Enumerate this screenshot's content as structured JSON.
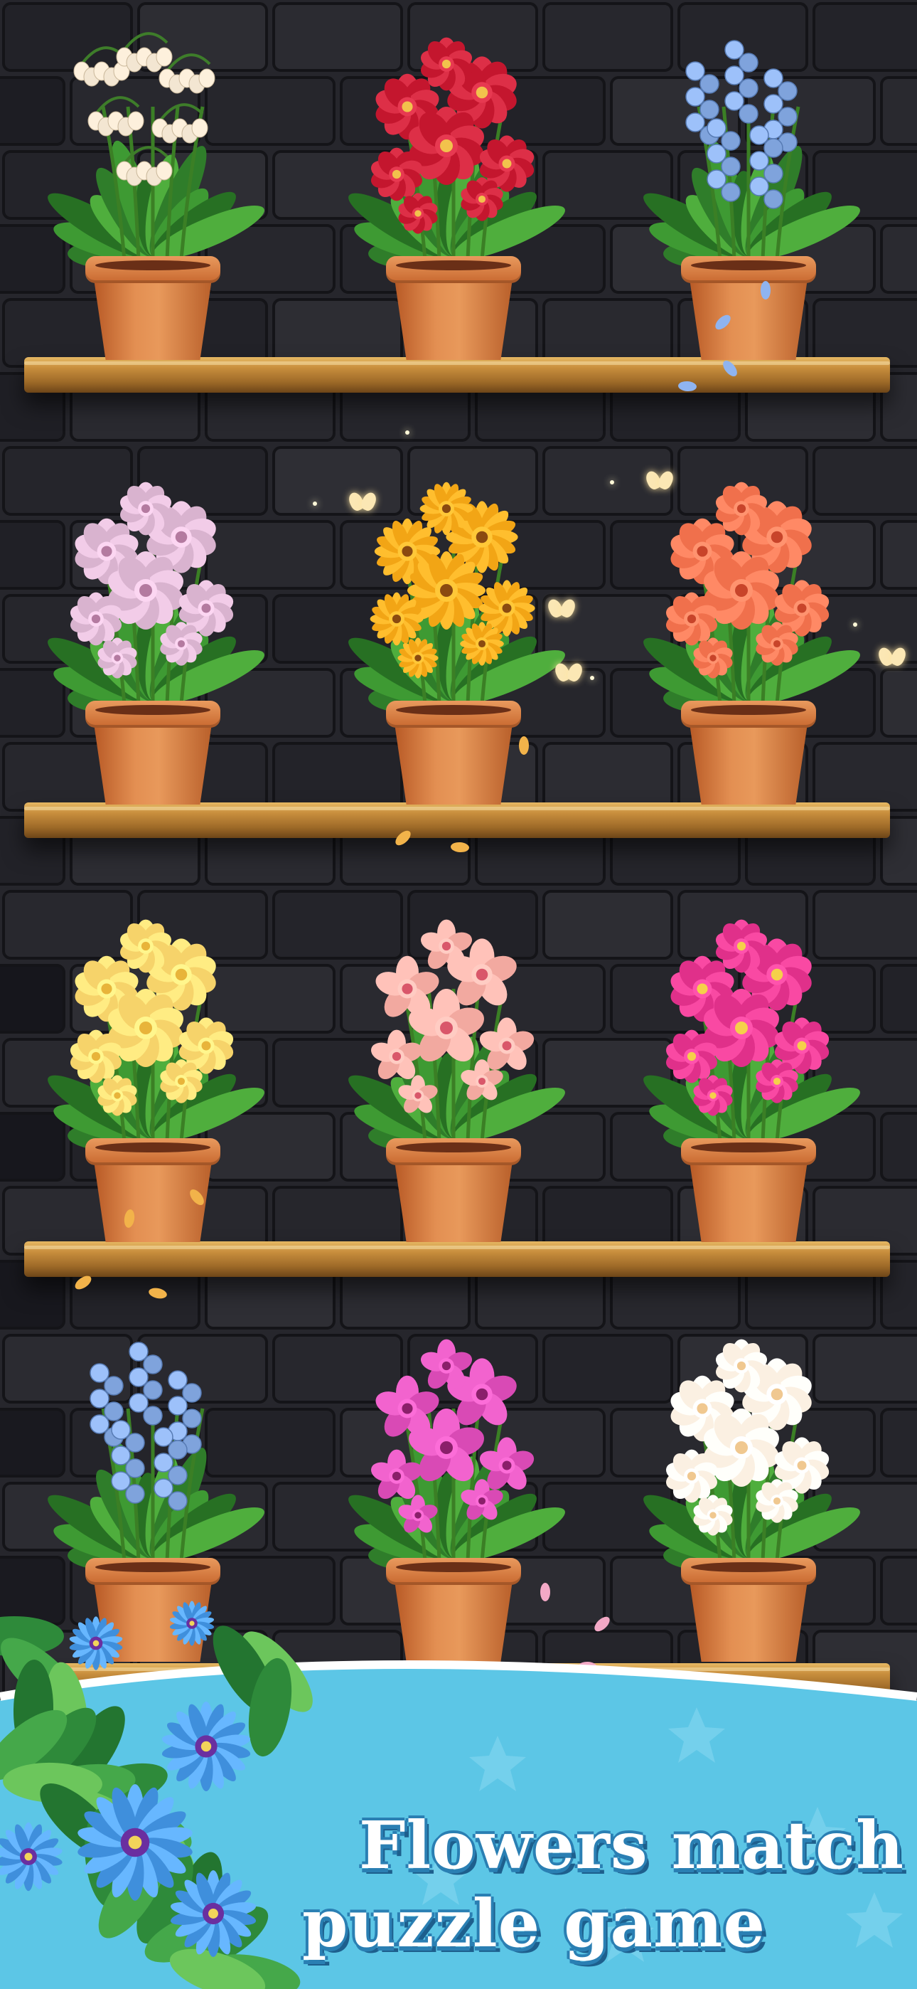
{
  "title": {
    "line1": "Flowers match",
    "line2": "puzzle game"
  },
  "colors": {
    "wall": "#26262c",
    "brick_line": "#141418",
    "shelf_wood": "#c88e3d",
    "pot_terracotta": "#d9773d",
    "banner_sky": "#5cc6e6",
    "title_text": "#ffffff",
    "title_outline": "#2a7fb3"
  },
  "shelves": [
    {
      "name": "shelf-1",
      "plants": [
        {
          "flower": "lily-of-the-valley",
          "petal": "#f3e6d2",
          "center": "#e9c89a"
        },
        {
          "flower": "camellia-red",
          "petal": "#c4162e",
          "center": "#f2c24c"
        },
        {
          "flower": "hyacinth-blue",
          "petal": "#7fa3dc",
          "center": "#dfe8ff"
        }
      ]
    },
    {
      "name": "shelf-2",
      "plants": [
        {
          "flower": "dahlia-pink",
          "petal": "#d9b3cf",
          "center": "#b47aa0"
        },
        {
          "flower": "sunflower-orange",
          "petal": "#f2a515",
          "center": "#8a4a10"
        },
        {
          "flower": "rose-coral",
          "petal": "#f0704c",
          "center": "#c8442a"
        }
      ]
    },
    {
      "name": "shelf-3",
      "plants": [
        {
          "flower": "chrysanthemum-yellow",
          "petal": "#f6d36a",
          "center": "#e8b43a"
        },
        {
          "flower": "lily-pink",
          "petal": "#f2a9a0",
          "center": "#d9576a"
        },
        {
          "flower": "peony-magenta",
          "petal": "#e0308a",
          "center": "#f5d04a"
        }
      ]
    },
    {
      "name": "shelf-4",
      "plants": [
        {
          "flower": "hyacinth-blue",
          "petal": "#7fa3dc",
          "center": "#dfe8ff"
        },
        {
          "flower": "orchid-magenta",
          "petal": "#d94ab5",
          "center": "#8a1f6a"
        },
        {
          "flower": "camellia-white",
          "petal": "#fbf0e2",
          "center": "#f0c890"
        }
      ]
    }
  ],
  "foreground": {
    "flower": "daisy-blue",
    "petal": "#3f8fdc",
    "center": "#6a2fa0"
  }
}
